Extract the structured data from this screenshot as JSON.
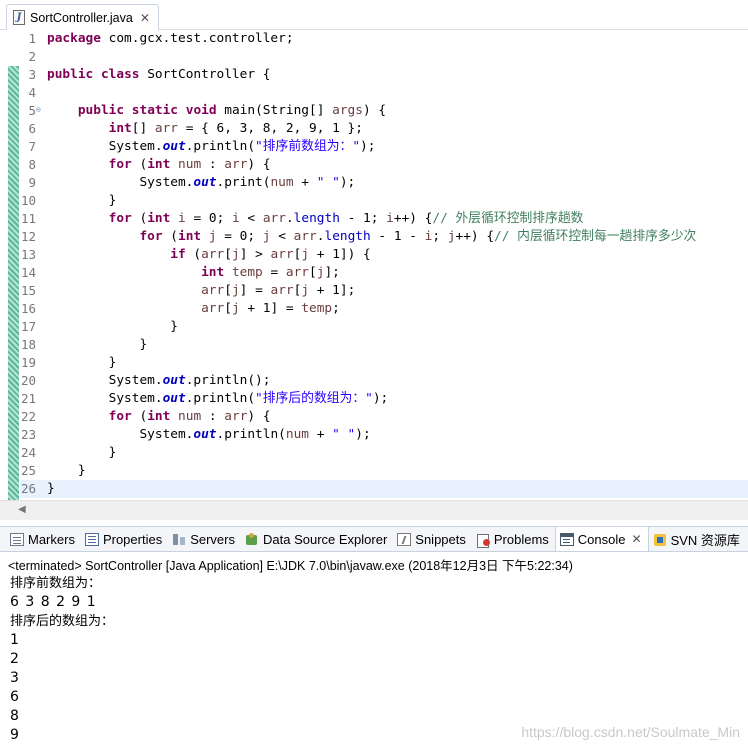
{
  "editor_tab": {
    "title": "SortController.java",
    "close": "✕"
  },
  "code": [
    {
      "n": "1",
      "parts": [
        [
          "kw",
          "package"
        ],
        [
          "t",
          " com.gcx.test.controller;"
        ]
      ]
    },
    {
      "n": "2",
      "parts": []
    },
    {
      "n": "3",
      "parts": [
        [
          "kw",
          "public"
        ],
        [
          "t",
          " "
        ],
        [
          "kw",
          "class"
        ],
        [
          "t",
          " SortController {"
        ]
      ]
    },
    {
      "n": "4",
      "parts": []
    },
    {
      "n": "5",
      "fold": true,
      "parts": [
        [
          "t",
          "    "
        ],
        [
          "kw",
          "public"
        ],
        [
          "t",
          " "
        ],
        [
          "kw",
          "static"
        ],
        [
          "t",
          " "
        ],
        [
          "kw",
          "void"
        ],
        [
          "t",
          " main(String[] "
        ],
        [
          "var",
          "args"
        ],
        [
          "t",
          ") {"
        ]
      ]
    },
    {
      "n": "6",
      "parts": [
        [
          "t",
          "        "
        ],
        [
          "kw",
          "int"
        ],
        [
          "t",
          "[] "
        ],
        [
          "var",
          "arr"
        ],
        [
          "t",
          " = { 6, 3, 8, 2, 9, 1 };"
        ]
      ]
    },
    {
      "n": "7",
      "parts": [
        [
          "t",
          "        System."
        ],
        [
          "fld",
          "out"
        ],
        [
          "t",
          ".println("
        ],
        [
          "str",
          "\"排序前数组为：\""
        ],
        [
          "t",
          ");"
        ]
      ]
    },
    {
      "n": "8",
      "parts": [
        [
          "t",
          "        "
        ],
        [
          "kw",
          "for"
        ],
        [
          "t",
          " ("
        ],
        [
          "kw",
          "int"
        ],
        [
          "t",
          " "
        ],
        [
          "var",
          "num"
        ],
        [
          "t",
          " : "
        ],
        [
          "var",
          "arr"
        ],
        [
          "t",
          ") {"
        ]
      ]
    },
    {
      "n": "9",
      "parts": [
        [
          "t",
          "            System."
        ],
        [
          "fld",
          "out"
        ],
        [
          "t",
          ".print("
        ],
        [
          "var",
          "num"
        ],
        [
          "t",
          " + "
        ],
        [
          "str",
          "\" \""
        ],
        [
          "t",
          ");"
        ]
      ]
    },
    {
      "n": "10",
      "parts": [
        [
          "t",
          "        }"
        ]
      ]
    },
    {
      "n": "11",
      "parts": [
        [
          "t",
          "        "
        ],
        [
          "kw",
          "for"
        ],
        [
          "t",
          " ("
        ],
        [
          "kw",
          "int"
        ],
        [
          "t",
          " "
        ],
        [
          "var",
          "i"
        ],
        [
          "t",
          " = 0; "
        ],
        [
          "var",
          "i"
        ],
        [
          "t",
          " < "
        ],
        [
          "var",
          "arr"
        ],
        [
          "t",
          "."
        ],
        [
          "fld2",
          "length"
        ],
        [
          "t",
          " - 1; "
        ],
        [
          "var",
          "i"
        ],
        [
          "t",
          "++) {"
        ],
        [
          "cmt",
          "// 外层循环控制排序趟数"
        ]
      ]
    },
    {
      "n": "12",
      "parts": [
        [
          "t",
          "            "
        ],
        [
          "kw",
          "for"
        ],
        [
          "t",
          " ("
        ],
        [
          "kw",
          "int"
        ],
        [
          "t",
          " "
        ],
        [
          "var",
          "j"
        ],
        [
          "t",
          " = 0; "
        ],
        [
          "var",
          "j"
        ],
        [
          "t",
          " < "
        ],
        [
          "var",
          "arr"
        ],
        [
          "t",
          "."
        ],
        [
          "fld2",
          "length"
        ],
        [
          "t",
          " - 1 - "
        ],
        [
          "var",
          "i"
        ],
        [
          "t",
          "; "
        ],
        [
          "var",
          "j"
        ],
        [
          "t",
          "++) {"
        ],
        [
          "cmt",
          "// 内层循环控制每一趟排序多少次"
        ]
      ]
    },
    {
      "n": "13",
      "parts": [
        [
          "t",
          "                "
        ],
        [
          "kw",
          "if"
        ],
        [
          "t",
          " ("
        ],
        [
          "var",
          "arr"
        ],
        [
          "t",
          "["
        ],
        [
          "var",
          "j"
        ],
        [
          "t",
          "] > "
        ],
        [
          "var",
          "arr"
        ],
        [
          "t",
          "["
        ],
        [
          "var",
          "j"
        ],
        [
          "t",
          " + 1]) {"
        ]
      ]
    },
    {
      "n": "14",
      "parts": [
        [
          "t",
          "                    "
        ],
        [
          "kw",
          "int"
        ],
        [
          "t",
          " "
        ],
        [
          "var",
          "temp"
        ],
        [
          "t",
          " = "
        ],
        [
          "var",
          "arr"
        ],
        [
          "t",
          "["
        ],
        [
          "var",
          "j"
        ],
        [
          "t",
          "];"
        ]
      ]
    },
    {
      "n": "15",
      "parts": [
        [
          "t",
          "                    "
        ],
        [
          "var",
          "arr"
        ],
        [
          "t",
          "["
        ],
        [
          "var",
          "j"
        ],
        [
          "t",
          "] = "
        ],
        [
          "var",
          "arr"
        ],
        [
          "t",
          "["
        ],
        [
          "var",
          "j"
        ],
        [
          "t",
          " + 1];"
        ]
      ]
    },
    {
      "n": "16",
      "parts": [
        [
          "t",
          "                    "
        ],
        [
          "var",
          "arr"
        ],
        [
          "t",
          "["
        ],
        [
          "var",
          "j"
        ],
        [
          "t",
          " + 1] = "
        ],
        [
          "var",
          "temp"
        ],
        [
          "t",
          ";"
        ]
      ]
    },
    {
      "n": "17",
      "parts": [
        [
          "t",
          "                }"
        ]
      ]
    },
    {
      "n": "18",
      "parts": [
        [
          "t",
          "            }"
        ]
      ]
    },
    {
      "n": "19",
      "parts": [
        [
          "t",
          "        }"
        ]
      ]
    },
    {
      "n": "20",
      "parts": [
        [
          "t",
          "        System."
        ],
        [
          "fld",
          "out"
        ],
        [
          "t",
          ".println();"
        ]
      ]
    },
    {
      "n": "21",
      "parts": [
        [
          "t",
          "        System."
        ],
        [
          "fld",
          "out"
        ],
        [
          "t",
          ".println("
        ],
        [
          "str",
          "\"排序后的数组为：\""
        ],
        [
          "t",
          ");"
        ]
      ]
    },
    {
      "n": "22",
      "parts": [
        [
          "t",
          "        "
        ],
        [
          "kw",
          "for"
        ],
        [
          "t",
          " ("
        ],
        [
          "kw",
          "int"
        ],
        [
          "t",
          " "
        ],
        [
          "var",
          "num"
        ],
        [
          "t",
          " : "
        ],
        [
          "var",
          "arr"
        ],
        [
          "t",
          ") {"
        ]
      ]
    },
    {
      "n": "23",
      "parts": [
        [
          "t",
          "            System."
        ],
        [
          "fld",
          "out"
        ],
        [
          "t",
          ".println("
        ],
        [
          "var",
          "num"
        ],
        [
          "t",
          " + "
        ],
        [
          "str",
          "\" \""
        ],
        [
          "t",
          ");"
        ]
      ]
    },
    {
      "n": "24",
      "parts": [
        [
          "t",
          "        }"
        ]
      ]
    },
    {
      "n": "25",
      "parts": [
        [
          "t",
          "    }"
        ]
      ]
    },
    {
      "n": "26",
      "current": true,
      "parts": [
        [
          "t",
          "}"
        ]
      ]
    }
  ],
  "view_tabs": [
    {
      "label": "Markers",
      "icon": "markers-icon",
      "cls": "i-markers"
    },
    {
      "label": "Properties",
      "icon": "properties-icon",
      "cls": "i-props"
    },
    {
      "label": "Servers",
      "icon": "servers-icon",
      "cls": "i-servers"
    },
    {
      "label": "Data Source Explorer",
      "icon": "data-source-explorer-icon",
      "cls": "i-dse"
    },
    {
      "label": "Snippets",
      "icon": "snippets-icon",
      "cls": "i-snip"
    },
    {
      "label": "Problems",
      "icon": "problems-icon",
      "cls": "i-problems"
    },
    {
      "label": "Console",
      "icon": "console-icon",
      "cls": "i-console",
      "active": true,
      "close": "✕"
    },
    {
      "label": "SVN 资源库",
      "icon": "svn-icon",
      "cls": "i-svn"
    }
  ],
  "console": {
    "header": "<terminated> SortController [Java Application] E:\\JDK 7.0\\bin\\javaw.exe (2018年12月3日 下午5:22:34)",
    "output": [
      {
        "text": "排序前数组为：",
        "num": false
      },
      {
        "text": "6 3 8 2 9 1 ",
        "num": true
      },
      {
        "text": "排序后的数组为：",
        "num": false
      },
      {
        "text": "1 ",
        "num": true
      },
      {
        "text": "2 ",
        "num": true
      },
      {
        "text": "3 ",
        "num": true
      },
      {
        "text": "6 ",
        "num": true
      },
      {
        "text": "8 ",
        "num": true
      },
      {
        "text": "9 ",
        "num": true
      }
    ],
    "watermark": "https://blog.csdn.net/Soulmate_Min"
  },
  "colors": {
    "keyword": "#7f0055",
    "string": "#2a00ff",
    "field": "#0000c0",
    "comment": "#3f7f5f",
    "local_var": "#6a3e3e",
    "current_line": "#e8f2fe"
  }
}
